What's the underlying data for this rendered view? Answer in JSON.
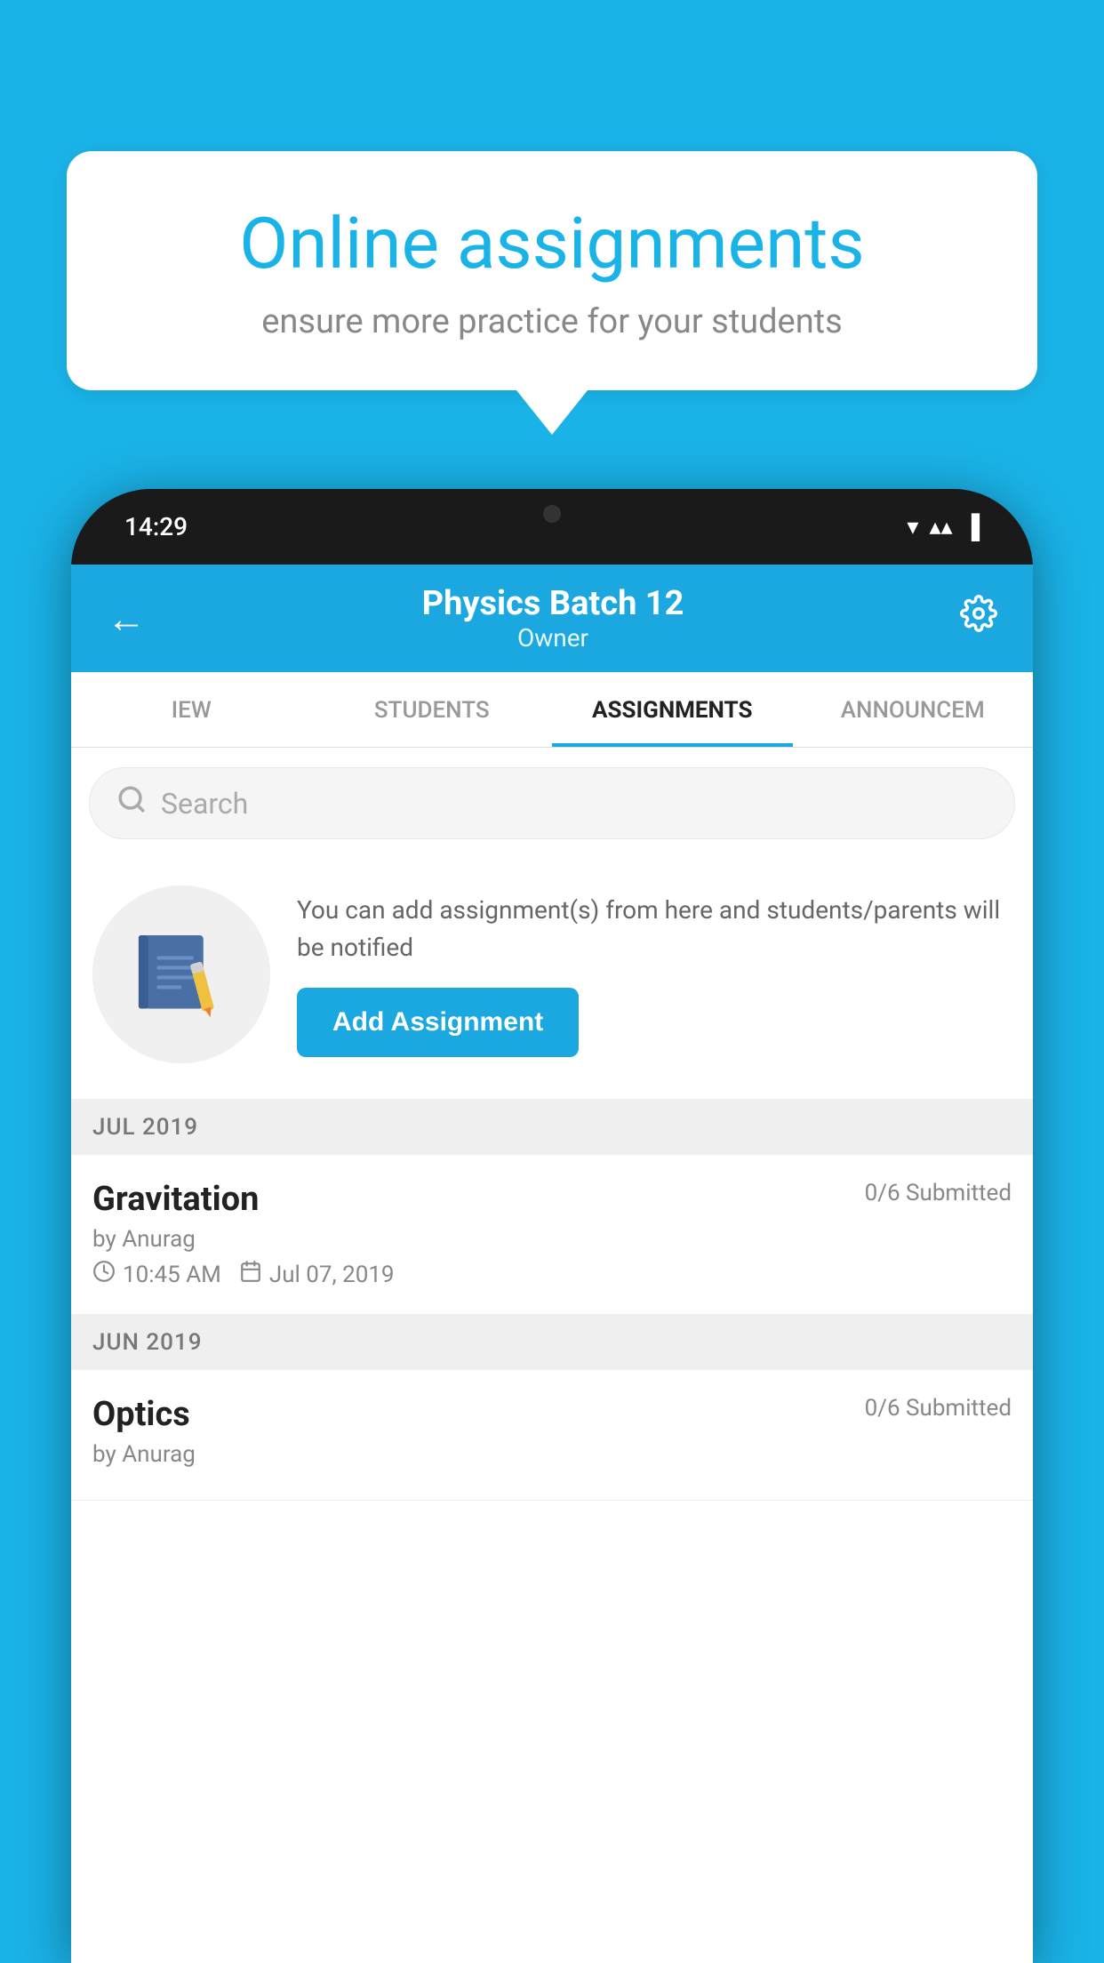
{
  "background_color": "#1ab3e8",
  "speech_bubble": {
    "title": "Online assignments",
    "subtitle": "ensure more practice for your students"
  },
  "phone": {
    "status_bar": {
      "time": "14:29",
      "wifi": "▼",
      "signal": "▲",
      "battery": "▐"
    },
    "header": {
      "title": "Physics Batch 12",
      "subtitle": "Owner",
      "back_label": "←",
      "settings_label": "⚙"
    },
    "tabs": [
      {
        "label": "IEW",
        "active": false
      },
      {
        "label": "STUDENTS",
        "active": false
      },
      {
        "label": "ASSIGNMENTS",
        "active": true
      },
      {
        "label": "ANNOUNCEM",
        "active": false
      }
    ],
    "search": {
      "placeholder": "Search"
    },
    "add_assignment_section": {
      "description": "You can add assignment(s) from here and students/parents will be notified",
      "button_label": "Add Assignment"
    },
    "sections": [
      {
        "label": "JUL 2019",
        "assignments": [
          {
            "name": "Gravitation",
            "submitted": "0/6 Submitted",
            "author": "by Anurag",
            "time": "10:45 AM",
            "date": "Jul 07, 2019"
          }
        ]
      },
      {
        "label": "JUN 2019",
        "assignments": [
          {
            "name": "Optics",
            "submitted": "0/6 Submitted",
            "author": "by Anurag",
            "time": "",
            "date": ""
          }
        ]
      }
    ]
  }
}
